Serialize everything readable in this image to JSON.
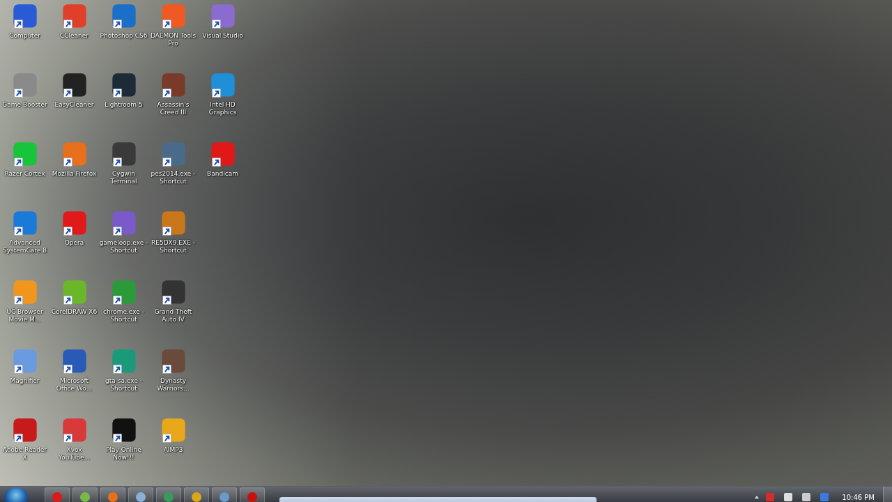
{
  "desktop_rows": [
    [
      {
        "label": "Computer",
        "color": "#2a5bd7"
      },
      {
        "label": "CCleaner",
        "color": "#e0402a"
      },
      {
        "label": "Photoshop CS6",
        "color": "#1c6fc9"
      },
      {
        "label": "DAEMON Tools Pro",
        "color": "#f05a22"
      },
      {
        "label": "Visual Studio",
        "color": "#8a6bd0"
      }
    ],
    [
      {
        "label": "Game Booster",
        "color": "#8a8a8a"
      },
      {
        "label": "EasyCleaner",
        "color": "#222222"
      },
      {
        "label": "Lightroom 5",
        "color": "#1d2a38"
      },
      {
        "label": "Assassin's Creed III",
        "color": "#7a3a2a"
      },
      {
        "label": "Intel HD Graphics",
        "color": "#1f8fd8"
      }
    ],
    [
      {
        "label": "Razer Cortex",
        "color": "#18c43a"
      },
      {
        "label": "Mozilla Firefox",
        "color": "#e8701c"
      },
      {
        "label": "Cygwin Terminal",
        "color": "#3a3a3a"
      },
      {
        "label": "pes2014.exe - Shortcut",
        "color": "#4a6a8a"
      },
      {
        "label": "Bandicam",
        "color": "#e01818"
      }
    ],
    [
      {
        "label": "Advanced SystemCare 8",
        "color": "#1a7ad8"
      },
      {
        "label": "Opera",
        "color": "#e01a1a"
      },
      {
        "label": "gameloop.exe - Shortcut",
        "color": "#7a5ac8"
      },
      {
        "label": "RE5DX9.EXE - Shortcut",
        "color": "#c8781a"
      }
    ],
    [
      {
        "label": "UC Browser Movie M...",
        "color": "#f0961c"
      },
      {
        "label": "CorelDRAW X6",
        "color": "#6ab82a"
      },
      {
        "label": "chrome.exe - Shortcut",
        "color": "#2a9a3a"
      },
      {
        "label": "Grand Theft Auto IV",
        "color": "#333333"
      }
    ],
    [
      {
        "label": "Magnifier",
        "color": "#6a9ae0"
      },
      {
        "label": "Microsoft Office Wo...",
        "color": "#2a5ab8"
      },
      {
        "label": "gta-sa.exe - Shortcut",
        "color": "#1a9a7a"
      },
      {
        "label": "Dynasty Warriors...",
        "color": "#6a4a3a"
      }
    ],
    [
      {
        "label": "Adobe Reader X",
        "color": "#c81a1a"
      },
      {
        "label": "Xvox YouTube...",
        "color": "#d83a3a"
      },
      {
        "label": "Play Online Now!!!",
        "color": "#111111"
      },
      {
        "label": "AIMP3",
        "color": "#e8a81a"
      }
    ]
  ],
  "taskbar": {
    "buttons": [
      {
        "color": "#e01818"
      },
      {
        "color": "#7ab84a"
      },
      {
        "color": "#e8701c"
      },
      {
        "color": "#8ab0d8"
      },
      {
        "color": "#3a9a5a"
      },
      {
        "color": "#d8a81a"
      },
      {
        "color": "#6a9ac8"
      },
      {
        "color": "#c81010"
      }
    ],
    "tray": [
      {
        "color": "#d82a2a"
      },
      {
        "color": "#dddddd"
      },
      {
        "color": "#cccccc"
      },
      {
        "color": "#3a7ae0"
      }
    ],
    "clock": "10:46 PM"
  }
}
